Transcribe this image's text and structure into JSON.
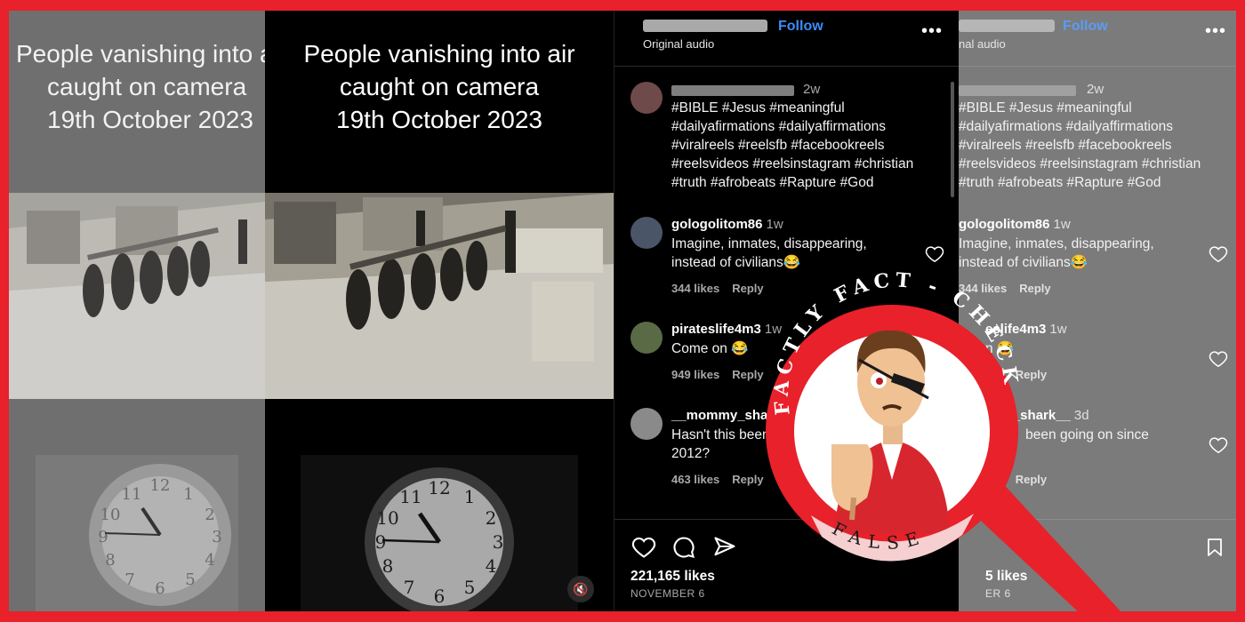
{
  "video": {
    "caption_lines": [
      "People vanishing into air",
      "caught on camera",
      "19th October 2023"
    ]
  },
  "post": {
    "follow_label": "Follow",
    "audio_label": "Original audio",
    "more_icon": "more-dots-icon",
    "caption_time": "2w",
    "caption_tags_lines": [
      "#BIBLE #Jesus #meaningful",
      "#dailyafirmations #dailyaffirmations",
      "#viralreels #reelsfb #facebookreels",
      "#reelsvideos #reelsinstagram #christian",
      "#truth #afrobeats #Rapture #God"
    ],
    "likes_label": "221,165 likes",
    "date_label": "NOVEMBER 6"
  },
  "comments": [
    {
      "username": "gologolitom86",
      "time": "1w",
      "text_lines": [
        "Imagine, inmates, disappearing,",
        "instead of civilians😂"
      ],
      "likes": "344 likes",
      "reply": "Reply"
    },
    {
      "username": "pirateslife4m3",
      "time": "1w",
      "text_lines": [
        "Come on 😂"
      ],
      "likes": "949 likes",
      "reply": "Reply"
    },
    {
      "username": "__mommy_shark__",
      "time": "3d",
      "text_lines": [
        "Hasn't this been going on since",
        "2012?"
      ],
      "likes": "463 likes",
      "reply": "Reply"
    }
  ],
  "grey_panel": {
    "follow_label": "Follow",
    "audio_label": "nal audio",
    "caption_time": "2w",
    "comment1_user": "gologolitom86",
    "comment1_time": "1w",
    "comment1_line1": "Imagine, inmates, disappearing,",
    "comment1_line2": "instead of civilians😂",
    "comment1_meta": "344 likes",
    "comment2_user": "eslife4m3",
    "comment2_time": "1w",
    "comment2_line1": "n 😂",
    "comment2_meta": "949",
    "comment3_user": "_mo",
    "comment3_user_b": "_shark__",
    "comment3_time": "3d",
    "comment3_line1a": "Hasn'",
    "comment3_line1b": "been going on since",
    "comment3_line2": "2012?",
    "comment3_meta": "463",
    "reply": "Reply",
    "likes_partial": "5 likes",
    "date_partial": "ER 6"
  },
  "badge": {
    "top_text": "FACTLY FACT - CHECK",
    "verdict": "FALSE",
    "colors": {
      "red": "#e8212a",
      "pink": "#f6cfd0",
      "white": "#ffffff"
    }
  },
  "colors": {
    "frame": "#e8212a",
    "follow": "#3b8cf7"
  }
}
